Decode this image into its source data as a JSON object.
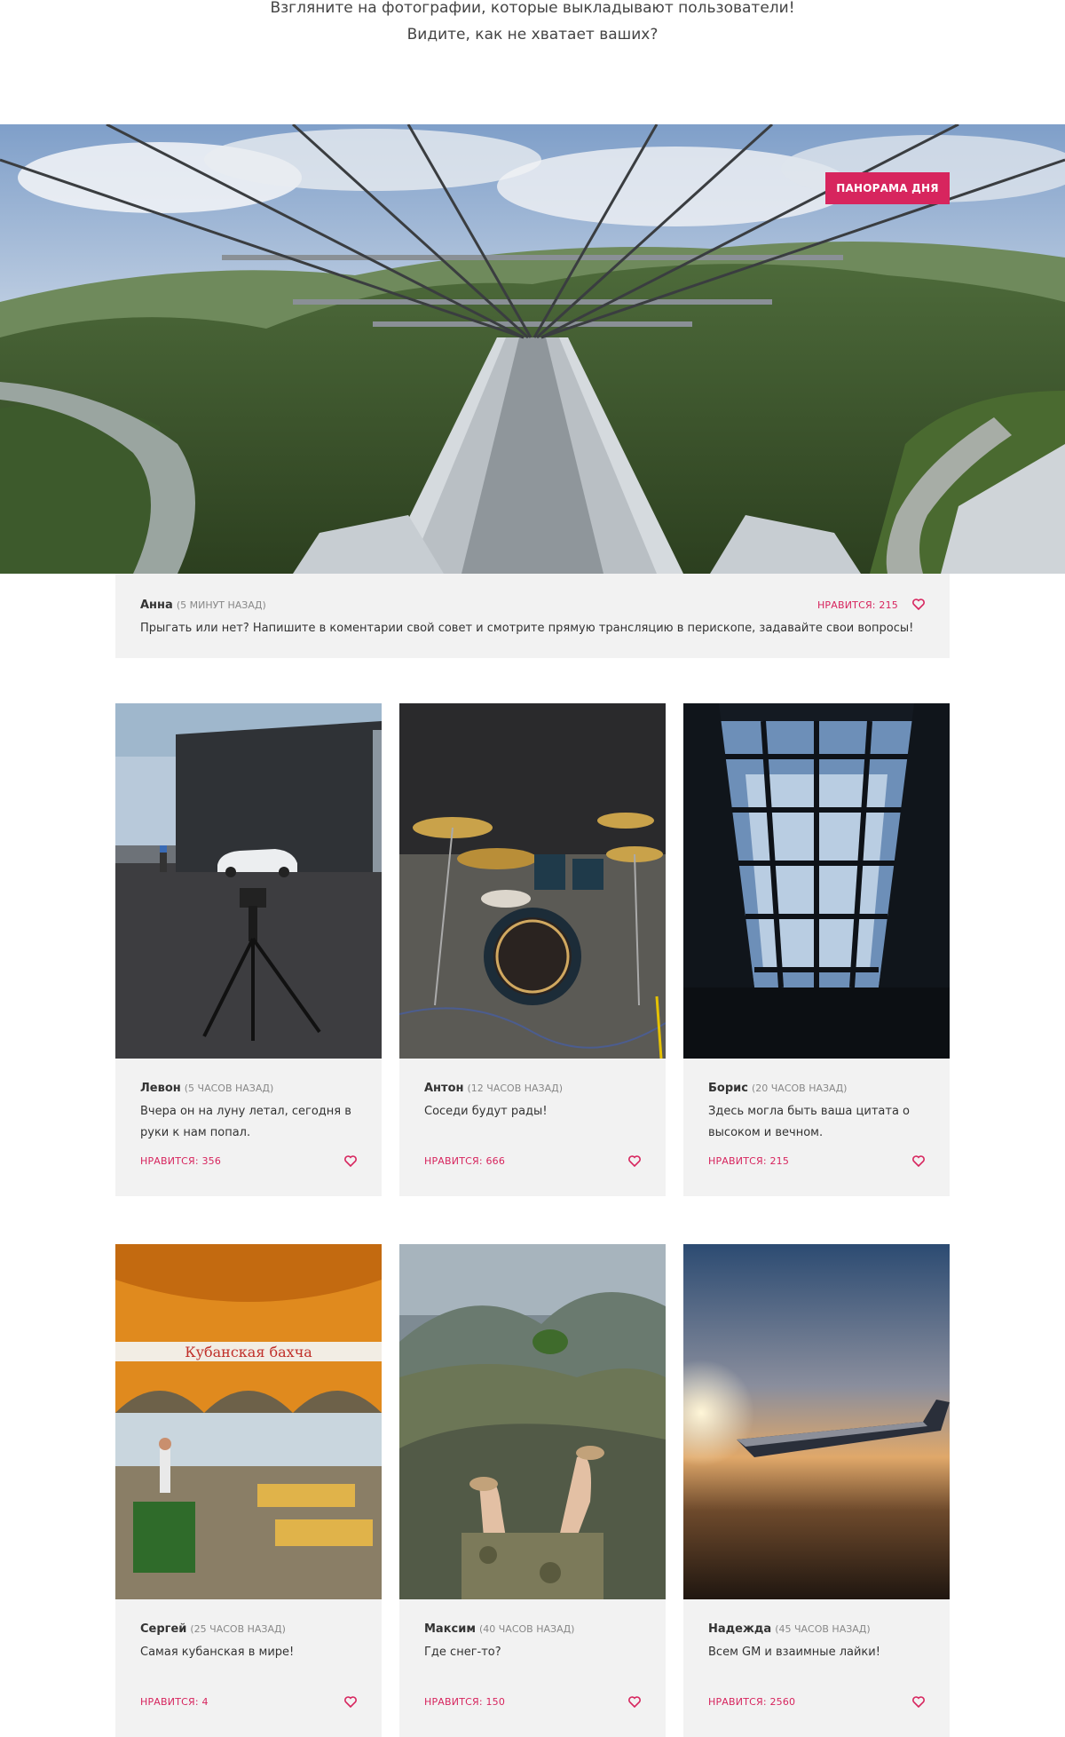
{
  "intro": {
    "line1": "Взгляните на фотографии, которые выкладывают пользователи!",
    "line2": "Видите, как не хватает ваших?"
  },
  "hero": {
    "badge": "ПАНОРАМА ДНЯ",
    "author": "Анна",
    "time": "(5 МИНУТ НАЗАД)",
    "likes": "НРАВИТСЯ: 215",
    "text": "Прыгать или нет? Напишите в коментарии свой совет и смотрите прямую трансляцию в перископе, задавайте свои вопросы!",
    "image": "suspension-bridge-panorama"
  },
  "cards": [
    {
      "author": "Левон",
      "time": "(5 ЧАСОВ НАЗАД)",
      "text": "Вчера он на луну летал, сегодня в руки к нам попал.",
      "likes": "НРАВИТСЯ: 356",
      "image": "camera-tripod-parking"
    },
    {
      "author": "Антон",
      "time": "(12 ЧАСОВ НАЗАД)",
      "text": "Соседи будут рады!",
      "likes": "НРАВИТСЯ: 666",
      "image": "drum-kit"
    },
    {
      "author": "Борис",
      "time": "(20 ЧАСОВ НАЗАД)",
      "text": "Здесь могла быть ваша цитата о высоком и вечном.",
      "likes": "НРАВИТСЯ: 215",
      "image": "glass-building"
    },
    {
      "author": "Сергей",
      "time": "(25 ЧАСОВ НАЗАД)",
      "text": "Самая кубанская в мире!",
      "likes": "НРАВИТСЯ: 4",
      "image": "market-tent"
    },
    {
      "author": "Максим",
      "time": "(40 ЧАСОВ НАЗАД)",
      "text": "Где снег-то?",
      "likes": "НРАВИТСЯ: 150",
      "image": "mountain-legs"
    },
    {
      "author": "Надежда",
      "time": "(45 ЧАСОВ НАЗАД)",
      "text": "Всем GM и взаимные лайки!",
      "likes": "НРАВИТСЯ: 2560",
      "image": "airplane-wing-sunset"
    }
  ],
  "market_sign": "Кубанская бахча",
  "colors": {
    "accent": "#d7255e",
    "card_bg": "#f2f2f2"
  }
}
